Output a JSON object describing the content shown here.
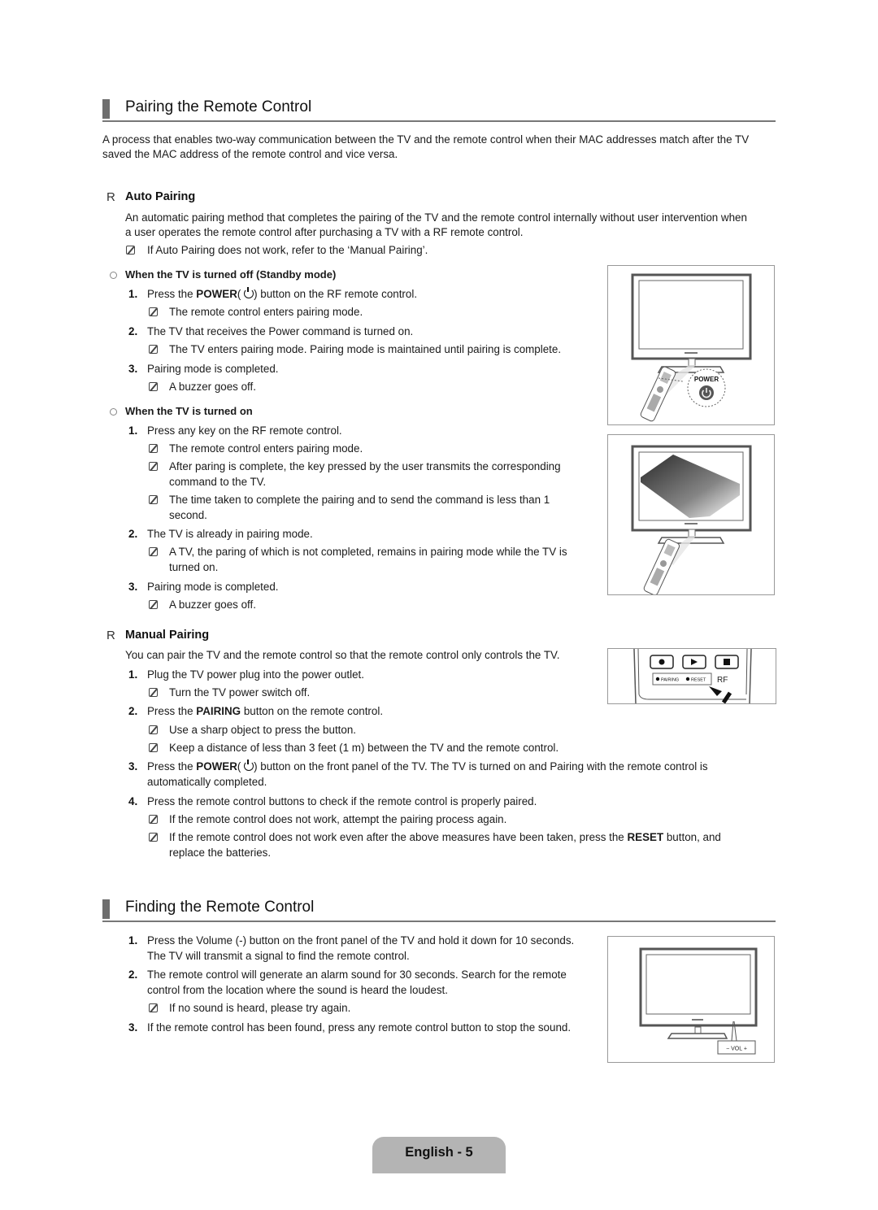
{
  "pairing": {
    "title": "Pairing the Remote Control",
    "intro_line1": "A process that enables two-way communication between the TV and the remote control when their MAC addresses match after the TV",
    "intro_line2": "saved the MAC address of the remote control and vice versa.",
    "auto": {
      "marker": "R",
      "title": "Auto Pairing",
      "desc_line1": "An automatic pairing method that completes the pairing of the TV and the remote control internally without user intervention when",
      "desc_line2": "a user operates the remote control after purchasing a TV with a RF remote control.",
      "note": "If Auto Pairing does not work, refer to the ‘Manual Pairing’.",
      "standby": {
        "title": "When the TV is turned off (Standby mode)",
        "steps": [
          {
            "num": "1.",
            "pre": "Press the ",
            "bold": "POWER",
            "post": ") button on the RF remote control.",
            "note": "The remote control enters pairing mode."
          },
          {
            "num": "2.",
            "text": "The TV that receives the Power command is turned on.",
            "note": "The TV enters pairing mode. Pairing mode is maintained until pairing is complete."
          },
          {
            "num": "3.",
            "text": "Pairing mode is completed.",
            "note": "A buzzer goes off."
          }
        ],
        "figure_label": "POWER"
      },
      "turned_on": {
        "title": "When the TV is turned on",
        "steps": [
          {
            "num": "1.",
            "text": "Press any key on the RF remote control.",
            "notes": [
              "The remote control enters pairing mode.",
              "After paring is complete, the key pressed by the user transmits the corresponding",
              "command to the TV.",
              "The time taken to complete the pairing and to send the command is less than 1",
              "second."
            ]
          },
          {
            "num": "2.",
            "text": "The TV is already in pairing mode.",
            "notes": [
              "A TV, the paring of which is not completed, remains in pairing mode while the TV is",
              "turned on."
            ]
          },
          {
            "num": "3.",
            "text": "Pairing mode is completed.",
            "notes": [
              "A buzzer goes off."
            ]
          }
        ]
      }
    },
    "manual": {
      "marker": "R",
      "title": "Manual Pairing",
      "desc": "You can pair the TV and the remote control so that the remote control only controls the TV.",
      "steps": [
        {
          "num": "1.",
          "text": "Plug the TV power plug into the power outlet.",
          "notes": [
            "Turn the TV power switch off."
          ]
        },
        {
          "num": "2.",
          "pre": "Press the ",
          "bold": "PAIRING",
          "post": " button on the remote control.",
          "notes": [
            "Use a sharp object to press the button.",
            "Keep a distance of less than 3 feet (1 m) between the TV and the remote control."
          ]
        },
        {
          "num": "3.",
          "pre": "Press the ",
          "bold": "POWER",
          "post": ") button on the front panel of the TV. The TV is turned on and Pairing with the remote control is",
          "cont": "automatically completed."
        },
        {
          "num": "4.",
          "text": "Press the remote control buttons to check if the remote control is properly paired.",
          "notes": [
            "If the remote control does not work, attempt the pairing process again."
          ],
          "note2_pre": "If the remote control does not work even after the above measures have been taken, press the ",
          "note2_bold": "RESET",
          "note2_post": " button, and",
          "note2_cont": "replace the batteries."
        }
      ],
      "figure": {
        "pairing_label": "PAIRING",
        "reset_label": "RESET",
        "rf_label": "RF"
      }
    }
  },
  "finding": {
    "title": "Finding the Remote Control",
    "steps": [
      {
        "num": "1.",
        "text": "Press the Volume (-) button on the front panel of the TV and hold it down for 10 seconds.",
        "cont": "The TV will transmit a signal to find the remote control."
      },
      {
        "num": "2.",
        "text": "The remote control will generate an alarm sound for 30 seconds. Search for the remote",
        "cont": "control from the location where the sound is heard the loudest.",
        "note": "If no sound is heard, please try again."
      },
      {
        "num": "3.",
        "text": "If the remote control has been found, press any remote control button to stop the sound."
      }
    ],
    "figure_label": "− VOL +"
  },
  "footer": {
    "page_label": "English - 5"
  }
}
